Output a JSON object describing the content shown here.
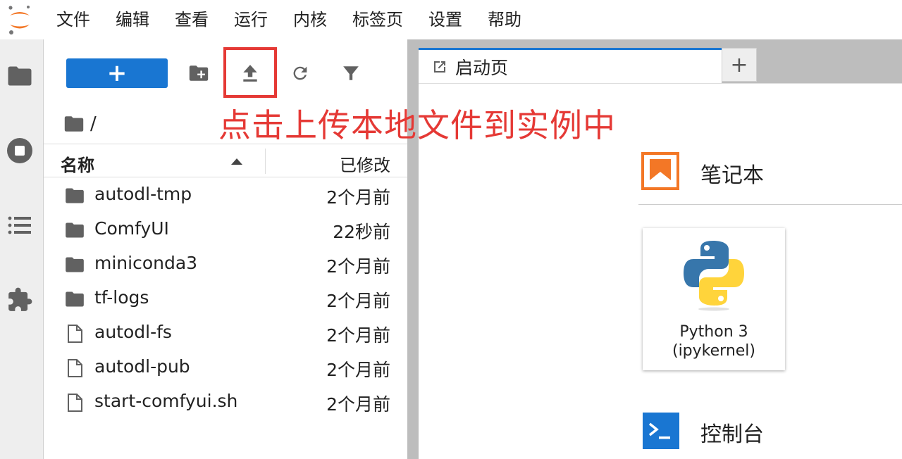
{
  "menu": [
    "文件",
    "编辑",
    "查看",
    "运行",
    "内核",
    "标签页",
    "设置",
    "帮助"
  ],
  "toolbar": {
    "new_label": "+"
  },
  "breadcrumb": {
    "separator": "/"
  },
  "file_list": {
    "header_name": "名称",
    "header_modified": "已修改",
    "rows": [
      {
        "name": "autodl-tmp",
        "modified": "2个月前",
        "type": "folder"
      },
      {
        "name": "ComfyUI",
        "modified": "22秒前",
        "type": "folder"
      },
      {
        "name": "miniconda3",
        "modified": "2个月前",
        "type": "folder"
      },
      {
        "name": "tf-logs",
        "modified": "2个月前",
        "type": "folder"
      },
      {
        "name": "autodl-fs",
        "modified": "2个月前",
        "type": "file"
      },
      {
        "name": "autodl-pub",
        "modified": "2个月前",
        "type": "file"
      },
      {
        "name": "start-comfyui.sh",
        "modified": "2个月前",
        "type": "file"
      }
    ]
  },
  "annotation": "点击上传本地文件到实例中",
  "tabs": [
    {
      "label": "启动页"
    }
  ],
  "add_tab_label": "+",
  "launcher": {
    "notebook_title": "笔记本",
    "kernel_name": "Python 3",
    "kernel_sub": "(ipykernel)",
    "console_title": "控制台"
  },
  "colors": {
    "accent": "#1976d2",
    "annotation": "#e53935",
    "notebook_icon": "#f37726"
  },
  "icons": [
    "jupyter-logo-icon",
    "folder-icon",
    "stop-circle-icon",
    "list-icon",
    "puzzle-icon",
    "new-folder-icon",
    "upload-icon",
    "refresh-icon",
    "filter-icon",
    "file-icon",
    "launcher-icon",
    "python-logo-icon",
    "terminal-icon"
  ]
}
